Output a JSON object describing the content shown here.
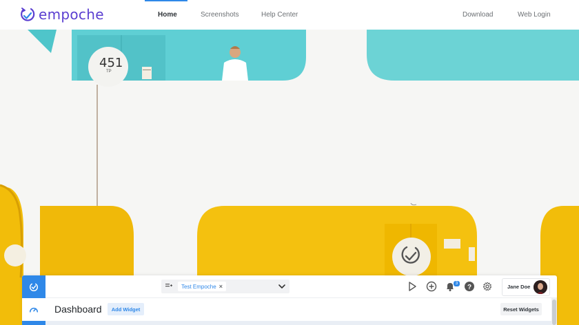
{
  "brand": {
    "name": "empoche",
    "color": "#5b3fd1"
  },
  "nav": {
    "links": [
      {
        "label": "Home",
        "active": true
      },
      {
        "label": "Screenshots",
        "active": false
      },
      {
        "label": "Help Center",
        "active": false
      }
    ],
    "right": [
      {
        "label": "Download"
      },
      {
        "label": "Web Login"
      }
    ],
    "accent": "#2f88e8"
  },
  "hero": {
    "door_number": "451",
    "door_sub": "TP",
    "colors": {
      "teal": "#5fcfd4",
      "yellow": "#f2bd0a",
      "wall": "#f6f6f4"
    }
  },
  "app": {
    "filter_chip": "Test Empoche",
    "notification_count": "3",
    "user_name": "Jane Doe",
    "page_title": "Dashboard",
    "add_widget_label": "Add Widget",
    "reset_widgets_label": "Reset Widgets",
    "icons": [
      "app-logo-icon",
      "dashboard-icon",
      "list-icon",
      "chevron-down-icon",
      "play-icon",
      "add-circle-icon",
      "bell-icon",
      "help-icon",
      "gear-icon"
    ]
  }
}
